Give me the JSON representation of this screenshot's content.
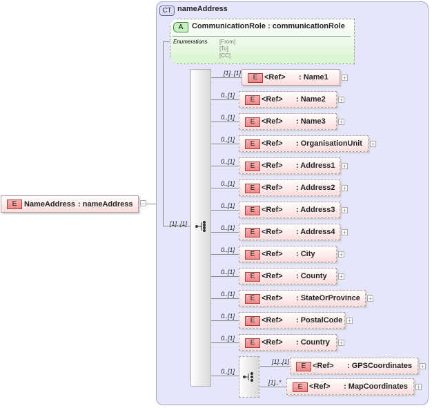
{
  "root": {
    "badge": "E",
    "name": "NameAddress",
    "type": "nameAddress",
    "occurrence": "[1]..[1]"
  },
  "complex_type": {
    "badge": "CT",
    "name": "nameAddress"
  },
  "attribute": {
    "badge": "A",
    "name": "CommunicationRole",
    "type": "communicationRole",
    "enum_label": "Enumerations",
    "enums": [
      "[From]",
      "[To]",
      "[CC]"
    ]
  },
  "elements": [
    {
      "occ": "[1]..[1]",
      "ref": "<Ref>",
      "name": ": Name1"
    },
    {
      "occ": "0..[1]",
      "ref": "<Ref>",
      "name": ": Name2"
    },
    {
      "occ": "0..[1]",
      "ref": "<Ref>",
      "name": ": Name3"
    },
    {
      "occ": "0..[1]",
      "ref": "<Ref>",
      "name": ": OrganisationUnit"
    },
    {
      "occ": "0..[1]",
      "ref": "<Ref>",
      "name": ": Address1"
    },
    {
      "occ": "0..[1]",
      "ref": "<Ref>",
      "name": ": Address2"
    },
    {
      "occ": "0..[1]",
      "ref": "<Ref>",
      "name": ": Address3"
    },
    {
      "occ": "0..[1]",
      "ref": "<Ref>",
      "name": ": Address4"
    },
    {
      "occ": "0..[1]",
      "ref": "<Ref>",
      "name": ": City"
    },
    {
      "occ": "0..[1]",
      "ref": "<Ref>",
      "name": ": County"
    },
    {
      "occ": "0..[1]",
      "ref": "<Ref>",
      "name": ": StateOrProvince"
    },
    {
      "occ": "0..[1]",
      "ref": "<Ref>",
      "name": ": PostalCode"
    },
    {
      "occ": "0..[1]",
      "ref": "<Ref>",
      "name": ": Country"
    }
  ],
  "choice": {
    "occ": "0..[1]",
    "items": [
      {
        "occ": "[1]..[1]",
        "ref": "<Ref>",
        "name": ": GPSCoordinates"
      },
      {
        "occ": "[1]..*",
        "ref": "<Ref>",
        "name": ": MapCoordinates"
      }
    ]
  },
  "badge_e": "E",
  "expand": "+",
  "collapse": "−"
}
